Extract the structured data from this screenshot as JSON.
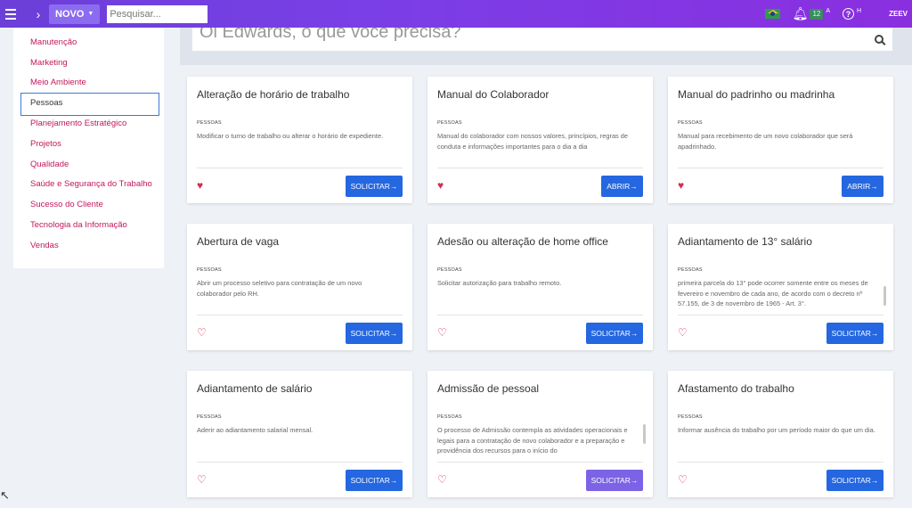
{
  "topbar": {
    "new_label": "NOVO",
    "search_placeholder": "Pesquisar...",
    "notification_count": "12",
    "notification_suffix": "A",
    "help_suffix": "H",
    "user_label": "ZEEV"
  },
  "sidebar": {
    "items": [
      {
        "label": "Manutenção"
      },
      {
        "label": "Marketing"
      },
      {
        "label": "Meio Ambiente"
      },
      {
        "label": "Pessoas"
      },
      {
        "label": "Planejamento Estratégico"
      },
      {
        "label": "Projetos"
      },
      {
        "label": "Qualidade"
      },
      {
        "label": "Saúde e Segurança do Trabalho"
      },
      {
        "label": "Sucesso do Cliente"
      },
      {
        "label": "Tecnologia da Informação"
      },
      {
        "label": "Vendas"
      }
    ],
    "active_index": 3
  },
  "hero": {
    "prompt": "Oi Edwards, o que você precisa?"
  },
  "cards": [
    {
      "title": "Alteração de horário de trabalho",
      "category": "PESSOAS",
      "description": "Modificar o turno de trabalho ou alterar o horário de expediente.",
      "favorite": true,
      "button": "SOLICITAR"
    },
    {
      "title": "Manual do Colaborador",
      "category": "PESSOAS",
      "description": "Manual do colaborador com nossos valores, princípios, regras de conduta e informações importantes para o dia a dia",
      "favorite": true,
      "button": "ABRIR"
    },
    {
      "title": "Manual do padrinho ou madrinha",
      "category": "PESSOAS",
      "description": "Manual para recebimento de um novo colaborador que será apadrinhado.",
      "favorite": true,
      "button": "ABRIR"
    },
    {
      "title": "Abertura de vaga",
      "category": "PESSOAS",
      "description": "Abrir um processo seletivo para contratação de um novo colaborador pelo RH.",
      "favorite": false,
      "button": "SOLICITAR"
    },
    {
      "title": "Adesão ou alteração de home office",
      "category": "PESSOAS",
      "description": "Solicitar autorização para trabalho remoto.",
      "favorite": false,
      "button": "SOLICITAR"
    },
    {
      "title": "Adiantamento de 13° salário",
      "category": "PESSOAS",
      "description": "primeira parcela do 13° pode ocorrer somente entre os meses de fevereiro e novembro de cada ano, de acordo com o decreto nº 57.155, de 3 de novembro de 1965 - Art. 3°.",
      "favorite": false,
      "button": "SOLICITAR"
    },
    {
      "title": "Adiantamento de salário",
      "category": "PESSOAS",
      "description": "Aderir ao adiantamento salarial mensal.",
      "favorite": false,
      "button": "SOLICITAR"
    },
    {
      "title": "Admissão de pessoal",
      "category": "PESSOAS",
      "description": "O processo de Admissão contempla as atividades operacionais e legais para a contratação de novo colaborador e a preparação e providência dos recursos para o início do",
      "favorite": false,
      "button": "SOLICITAR"
    },
    {
      "title": "Afastamento do trabalho",
      "category": "PESSOAS",
      "description": "Informar ausência do trabalho por um período maior do que um dia.",
      "favorite": false,
      "button": "SOLICITAR"
    }
  ],
  "colors": {
    "topbar": "#7a3fe6",
    "link": "#c2185b",
    "primary_button": "#2467e0",
    "hover_button": "#7c63e6",
    "heart": "#d32f4f"
  }
}
